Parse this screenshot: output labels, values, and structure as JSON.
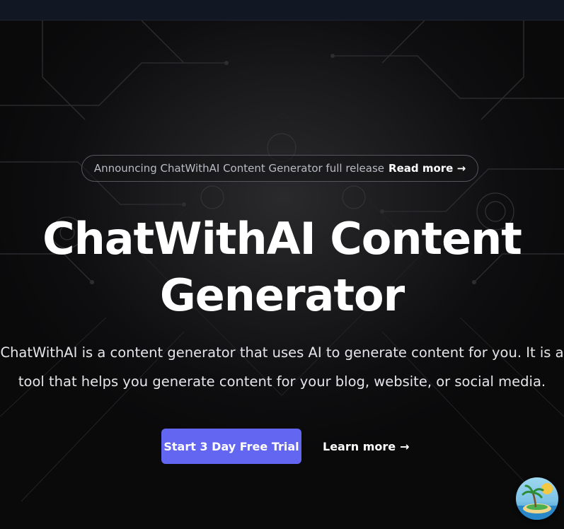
{
  "announcement": {
    "text": "Announcing ChatWithAI Content Generator full release",
    "link_label": "Read more",
    "link_arrow": "→"
  },
  "hero": {
    "title_line1": "ChatWithAI Content",
    "title_line2": "Generator",
    "description_line1": "ChatWithAI is a content generator that uses AI to generate content for you. It is a",
    "description_line2": "tool that helps you generate content for your blog, website, or social media."
  },
  "actions": {
    "primary_label": "Start 3 Day Free Trial",
    "secondary_label": "Learn more",
    "secondary_arrow": "→"
  },
  "widget": {
    "icon": "island-icon"
  },
  "colors": {
    "accent": "#6366f1",
    "background": "#0c0c0e",
    "topbar": "#121724"
  }
}
